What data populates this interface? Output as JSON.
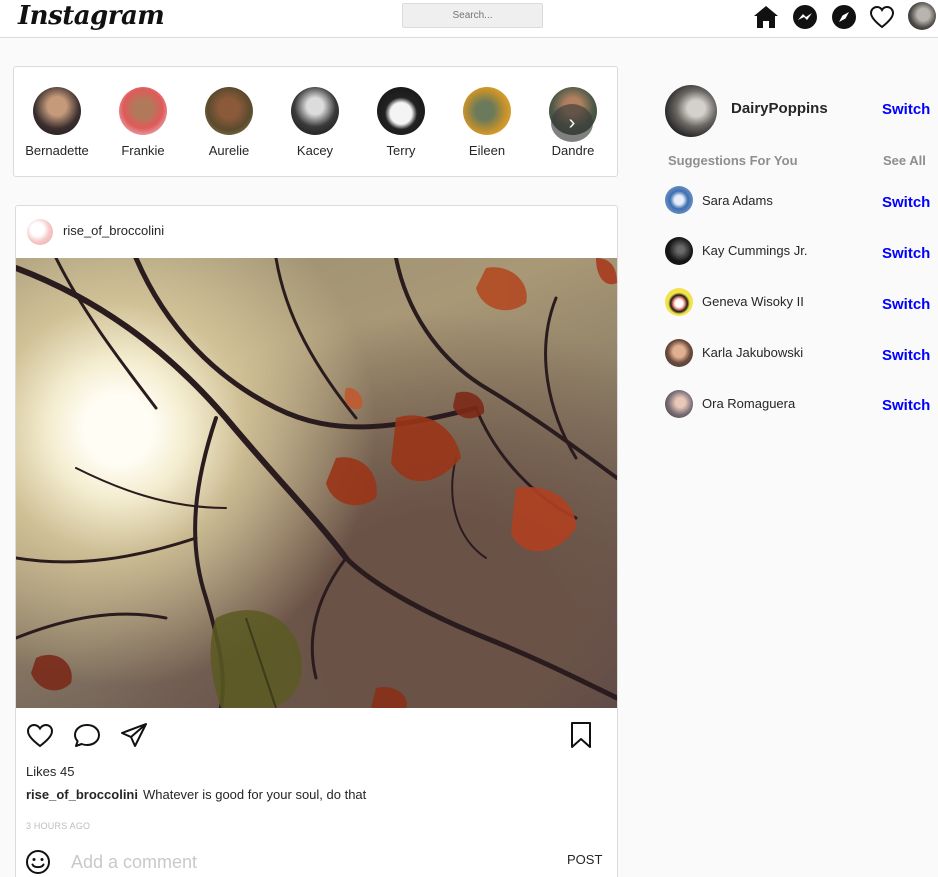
{
  "header": {
    "logo": "Instagram",
    "search_placeholder": "Search...",
    "icons": [
      "home-icon",
      "messenger-icon",
      "explore-icon",
      "heart-icon"
    ]
  },
  "stories": [
    {
      "name": "Bernadette",
      "bg": "#4a3a3a"
    },
    {
      "name": "Frankie",
      "bg": "#e26a6a"
    },
    {
      "name": "Aurelie",
      "bg": "#6b4b2e"
    },
    {
      "name": "Kacey",
      "bg": "#2b2b2b"
    },
    {
      "name": "Terry",
      "bg": "#1e1e1e"
    },
    {
      "name": "Eileen",
      "bg": "#d0a030"
    },
    {
      "name": "Dandre",
      "bg": "#4d5a48"
    }
  ],
  "post": {
    "username": "rise_of_broccolini",
    "likes": "Likes 45",
    "caption_user": "rise_of_broccolini",
    "caption_text": "Whatever is good for your soul, do that",
    "time": "3 HOURS AGO",
    "comment_placeholder": "Add a comment",
    "post_label": "POST"
  },
  "sidebar": {
    "me": {
      "name": "DairyPoppins",
      "switch": "Switch"
    },
    "suggestions_title": "Suggestions For You",
    "see_all": "See All",
    "suggestions": [
      {
        "name": "Sara Adams",
        "switch": "Switch",
        "bg": "#3d6fb3"
      },
      {
        "name": "Kay Cummings Jr.",
        "switch": "Switch",
        "bg": "#151515"
      },
      {
        "name": "Geneva Wisoky II",
        "switch": "Switch",
        "bg": "#f2e34a"
      },
      {
        "name": "Karla Jakubowski",
        "switch": "Switch",
        "bg": "#8a6a55"
      },
      {
        "name": "Ora Romaguera",
        "switch": "Switch",
        "bg": "#7a6e76"
      }
    ]
  },
  "colors": {
    "link": "#0000ff",
    "border": "#dbdbdb",
    "muted": "#8e8e8e"
  }
}
